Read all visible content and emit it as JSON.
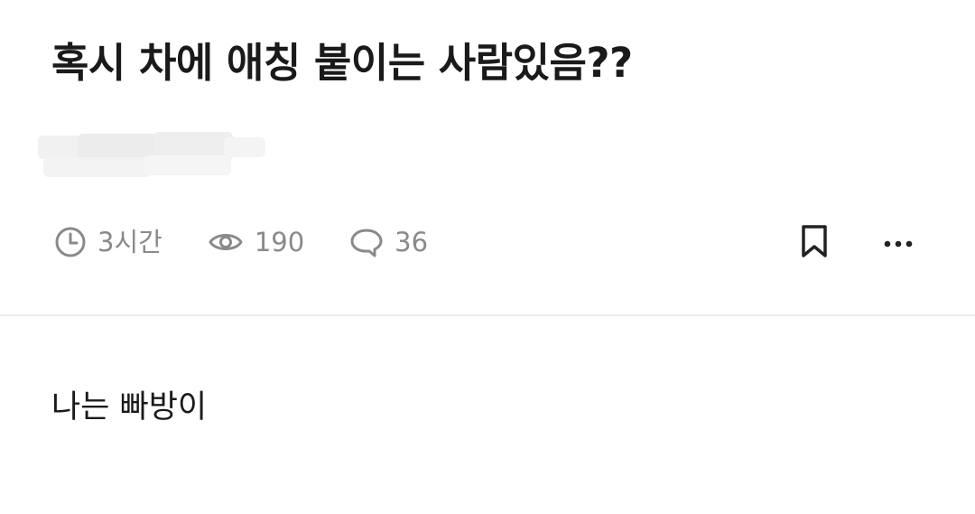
{
  "post": {
    "title": "혹시 차에 애칭 붙이는 사람있음??",
    "body": "나는 빠방이"
  },
  "meta": {
    "time": "3시간",
    "views": "190",
    "comments": "36"
  },
  "icons": {
    "time": "clock-icon",
    "views": "eye-icon",
    "comments": "comment-icon",
    "bookmark": "bookmark-icon",
    "more": "more-dots-icon"
  },
  "colors": {
    "title": "#1a1a1a",
    "meta": "#8a8a8a",
    "divider": "#ebebeb"
  }
}
